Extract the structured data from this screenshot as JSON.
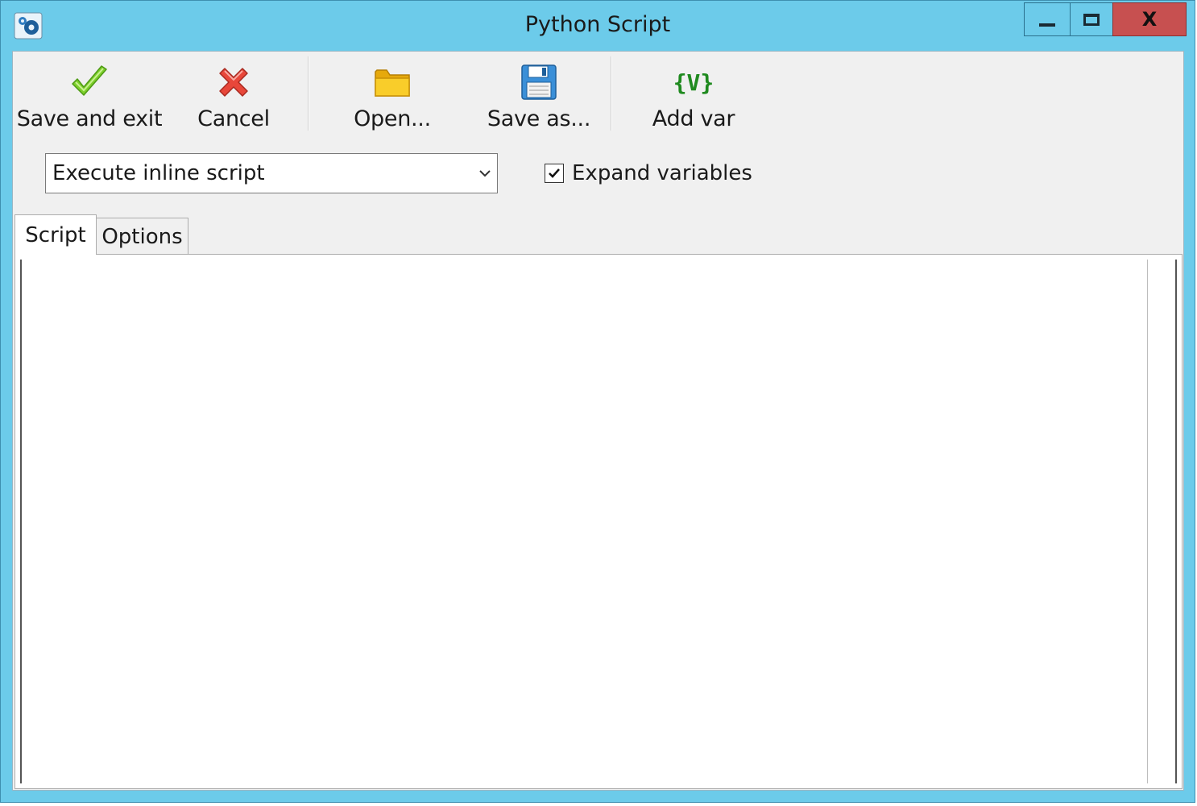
{
  "window": {
    "title": "Python Script",
    "close_glyph": "X",
    "app_icon": "python-gear-icon"
  },
  "toolbar": {
    "save_exit_label": "Save and exit",
    "cancel_label": "Cancel",
    "open_label": "Open...",
    "save_as_label": "Save as...",
    "add_var_label": "Add var",
    "add_var_glyph": "{V}",
    "icons": {
      "save_exit": "checkmark-icon",
      "cancel": "red-x-icon",
      "open": "folder-icon",
      "save_as": "floppy-disk-icon",
      "add_var": "variable-icon"
    }
  },
  "mode_select": {
    "value": "Execute inline script"
  },
  "expand_variables": {
    "label": "Expand variables",
    "checked": true
  },
  "tabs": [
    {
      "label": "Script",
      "active": true
    },
    {
      "label": "Options",
      "active": false
    }
  ],
  "editor": {
    "content": ""
  },
  "colors": {
    "titlebar": "#6ccbea",
    "close_button": "#c75050",
    "client_bg": "#f0f0f0",
    "check_green": "#7ccf2a",
    "cancel_red": "#e8473a",
    "folder_yellow": "#f7c51b",
    "floppy_blue": "#3a8fd8",
    "var_green": "#1f8a1f"
  }
}
